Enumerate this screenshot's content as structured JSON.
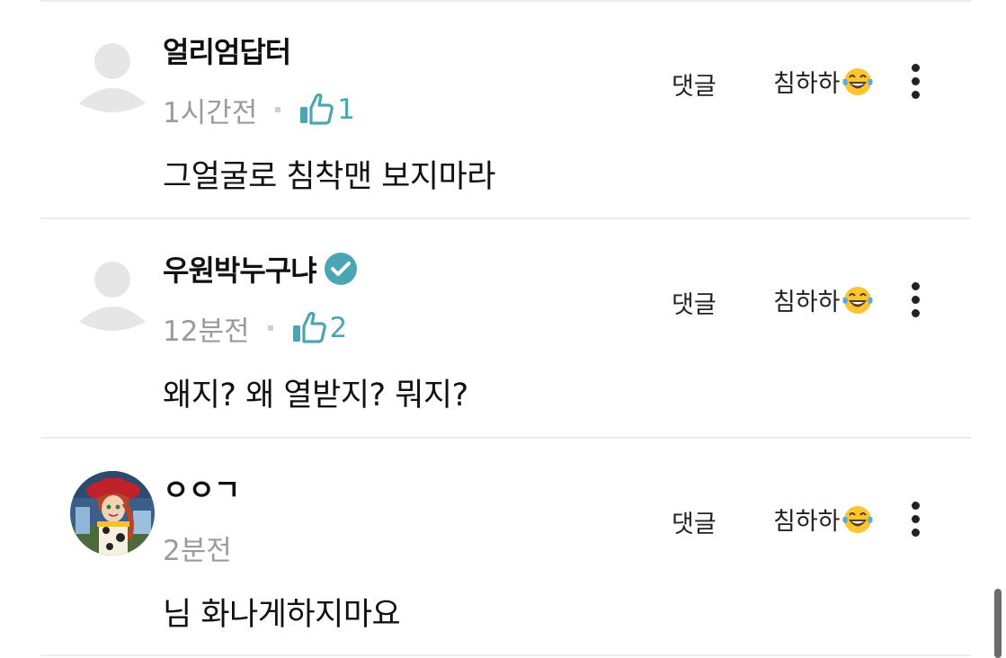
{
  "comments": [
    {
      "username": "얼리엄답터",
      "verified": false,
      "time": "1시간전",
      "likes": "1",
      "text": "그얼굴로 침착맨 보지마라",
      "reply_label": "댓글",
      "reaction_label": "침하하",
      "avatar": "default-avatar"
    },
    {
      "username": "우원박누구냐",
      "verified": true,
      "time": "12분전",
      "likes": "2",
      "text": "왜지? 왜 열받지? 뭐지?",
      "reply_label": "댓글",
      "reaction_label": "침하하",
      "avatar": "default-avatar"
    },
    {
      "username": "ㅇㅇㄱ",
      "verified": false,
      "time": "2분전",
      "likes": "",
      "text": "님 화나게하지마요",
      "reply_label": "댓글",
      "reaction_label": "침하하",
      "avatar": "cartoon-cowgirl-avatar"
    }
  ],
  "colors": {
    "accent": "#4aa6b2",
    "meta_text": "#9b9b9b",
    "divider": "#ececec",
    "avatar_placeholder": "#e6e6e6"
  },
  "icons": {
    "like": "thumbs-up-icon",
    "verified": "verified-check-icon",
    "reaction": "laughing-tears-emoji-icon",
    "more": "more-vertical-icon"
  }
}
